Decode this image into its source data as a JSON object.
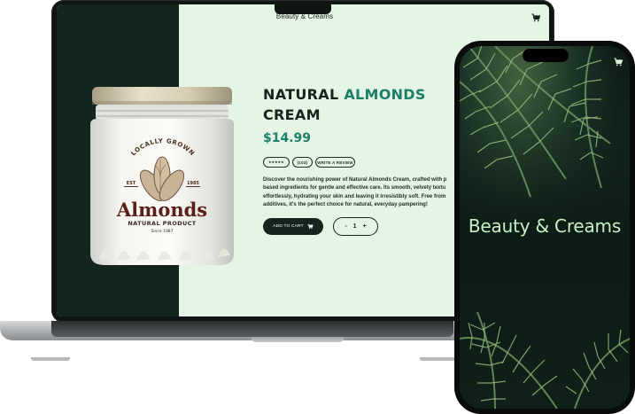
{
  "laptop": {
    "site_title": "Beauty & Creams",
    "product": {
      "name_part1": "NATURAL ",
      "name_accent": "ALMONDS",
      "name_part2": "CREAM",
      "price": "$14.99",
      "stars": "★★★★★",
      "review_count": "(103)",
      "write_review_label": "WRITE A REVIEW",
      "description_lines": [
        "Discover the nourishing power of Natural Almonds Cream, crafted with p",
        "based ingredients for gentle and effective care. Its smooth, velvety textu",
        "effortlessly, hydrating your skin and leaving it irresistibly soft. Free from",
        "additives, it's the perfect choice for natural, everyday pampering!"
      ],
      "add_to_cart_label": "ADD TO CART",
      "quantity": {
        "minus": "-",
        "value": "1",
        "plus": "+"
      }
    },
    "jar_label": {
      "top_text": "LOCALLY GROWN",
      "left_year": "EST",
      "right_year": "1985",
      "brand": "Almonds",
      "subtitle": "NATURAL PRODUCT",
      "since": "Since 1987"
    }
  },
  "phone": {
    "title": "Beauty & Creams"
  },
  "colors": {
    "accent": "#1e7f68",
    "dark_green": "#13261e",
    "mint_bg": "#e4f5e6",
    "phone_title": "#c7f0c6"
  },
  "icons": [
    "cart-icon",
    "star-icon"
  ]
}
